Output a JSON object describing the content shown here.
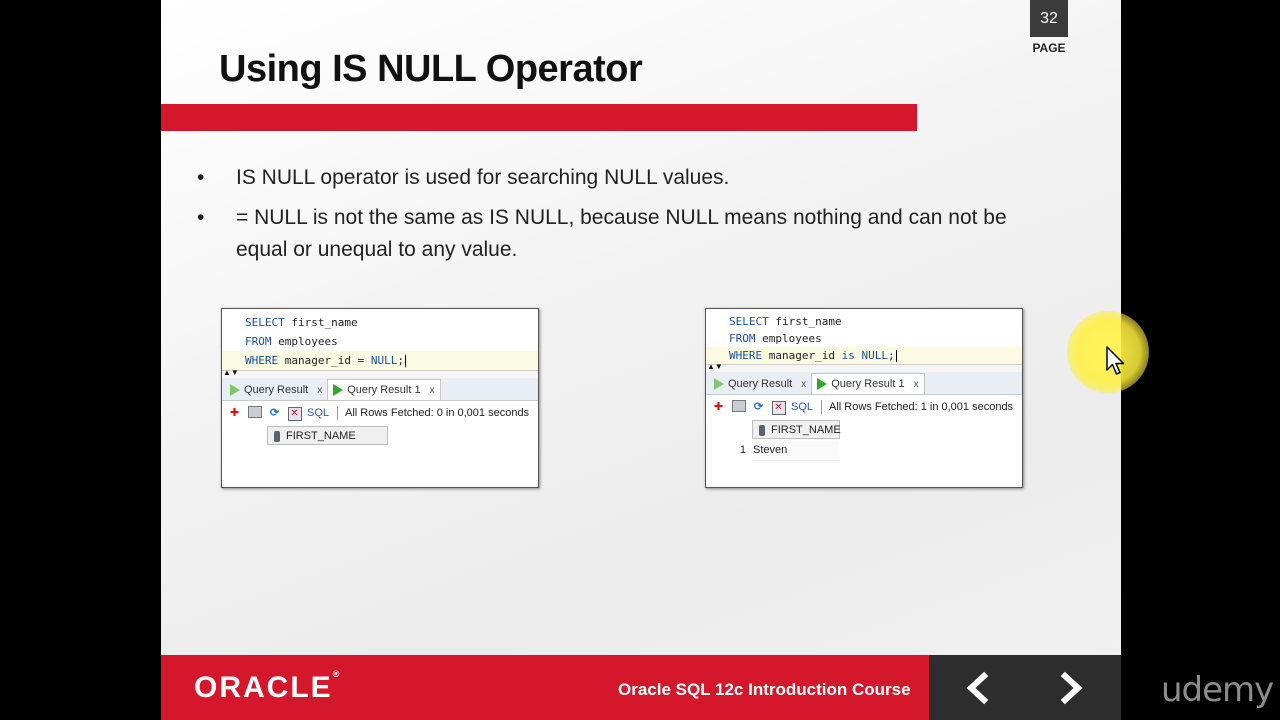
{
  "slide": {
    "title": "Using IS NULL Operator",
    "page_number": "32",
    "page_label": "PAGE",
    "bullets": [
      "IS NULL operator is used for searching NULL values.",
      "= NULL is not the same as IS NULL, because NULL means nothing and can not be equal or unequal to any value."
    ],
    "bullet_glyph": "•"
  },
  "panels": {
    "left": {
      "code": [
        {
          "kw": "SELECT",
          "rest": " first_name"
        },
        {
          "kw": "FROM",
          "rest": " employees"
        },
        {
          "kw": "WHERE",
          "rest": " manager_id = ",
          "kw2": "NULL",
          "end": ";"
        }
      ],
      "tabs": [
        {
          "label": "Query Result",
          "close": "x"
        },
        {
          "label": "Query Result 1",
          "close": "x"
        }
      ],
      "sql_label": "SQL",
      "status": "All Rows Fetched: 0 in 0,001 seconds",
      "column": "FIRST_NAME",
      "rows": []
    },
    "right": {
      "code": [
        {
          "kw": "SELECT",
          "rest": " first_name"
        },
        {
          "kw": "FROM",
          "rest": " employees"
        },
        {
          "kw": "WHERE",
          "rest": " manager_id ",
          "kw2": "is NULL",
          "end": ";"
        }
      ],
      "tabs": [
        {
          "label": "Query Result",
          "close": "x"
        },
        {
          "label": "Query Result 1",
          "close": "x"
        }
      ],
      "sql_label": "SQL",
      "status": "All Rows Fetched: 1 in 0,001 seconds",
      "column": "FIRST_NAME",
      "rows": [
        {
          "num": "1",
          "value": "Steven"
        }
      ]
    }
  },
  "footer": {
    "logo": "ORACLE",
    "logo_mark": "®",
    "course": "Oracle SQL 12c Introduction Course",
    "prev_icon": "chevron-left-icon",
    "next_icon": "chevron-right-icon"
  },
  "watermark": "udemy",
  "colors": {
    "accent_red": "#d4172a",
    "footer_dark": "#2d2d2d",
    "sql_keyword": "#1d4fa0",
    "highlight_yellow": "#fff550"
  }
}
